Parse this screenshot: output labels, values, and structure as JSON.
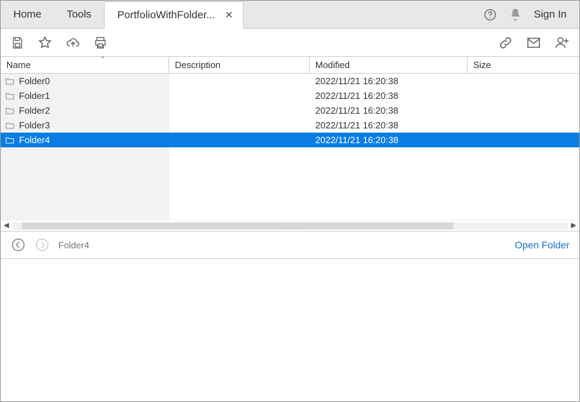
{
  "tabs": {
    "home": "Home",
    "tools": "Tools",
    "doc": "PortfolioWithFolder..."
  },
  "signin": "Sign In",
  "columns": {
    "name": "Name",
    "description": "Description",
    "modified": "Modified",
    "size": "Size"
  },
  "rows": [
    {
      "name": "Folder0",
      "description": "",
      "modified": "2022/11/21 16:20:38",
      "size": "",
      "selected": false
    },
    {
      "name": "Folder1",
      "description": "",
      "modified": "2022/11/21 16:20:38",
      "size": "",
      "selected": false
    },
    {
      "name": "Folder2",
      "description": "",
      "modified": "2022/11/21 16:20:38",
      "size": "",
      "selected": false
    },
    {
      "name": "Folder3",
      "description": "",
      "modified": "2022/11/21 16:20:38",
      "size": "",
      "selected": false
    },
    {
      "name": "Folder4",
      "description": "",
      "modified": "2022/11/21 16:20:38",
      "size": "",
      "selected": true
    }
  ],
  "nav": {
    "path": "Folder4",
    "action": "Open Folder"
  }
}
